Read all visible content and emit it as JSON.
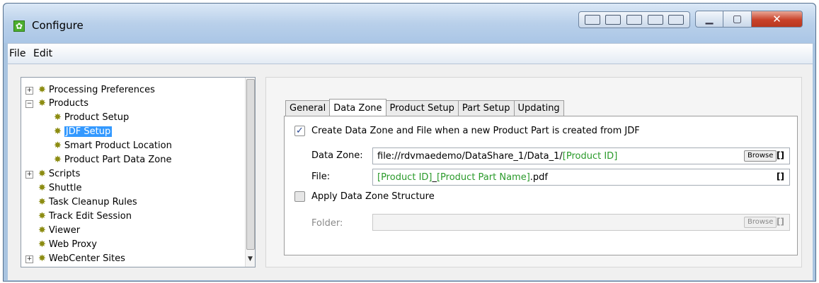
{
  "window": {
    "title": "Configure"
  },
  "menu": {
    "file": "File",
    "edit": "Edit"
  },
  "tree": {
    "items": [
      {
        "label": "Processing Preferences"
      },
      {
        "label": "Products"
      },
      {
        "label": "Product Setup"
      },
      {
        "label": "JDF Setup"
      },
      {
        "label": "Smart Product Location"
      },
      {
        "label": "Product Part Data Zone"
      },
      {
        "label": "Scripts"
      },
      {
        "label": "Shuttle"
      },
      {
        "label": "Task Cleanup Rules"
      },
      {
        "label": "Track Edit Session"
      },
      {
        "label": "Viewer"
      },
      {
        "label": "Web Proxy"
      },
      {
        "label": "WebCenter Sites"
      }
    ]
  },
  "tabs": [
    "General",
    "Data Zone",
    "Product Setup",
    "Part Setup",
    "Updating"
  ],
  "active_tab": "Data Zone",
  "data_zone": {
    "create_checkbox": {
      "label": "Create Data Zone and File when a new Product Part is created from JDF",
      "checked": true
    },
    "data_zone_label": "Data Zone:",
    "data_zone_value_prefix": "file://rdvmaedemo/DataShare_1/Data_1/",
    "data_zone_value_token": "[Product ID]",
    "file_label": "File:",
    "file_token_1": "[Product ID]",
    "file_sep": "_",
    "file_token_2": "[Product Part Name]",
    "file_suffix": ".pdf",
    "apply_checkbox": {
      "label": "Apply Data Zone Structure",
      "checked": false
    },
    "folder_label": "Folder:",
    "browse": "Browse",
    "brackets": "[]"
  }
}
